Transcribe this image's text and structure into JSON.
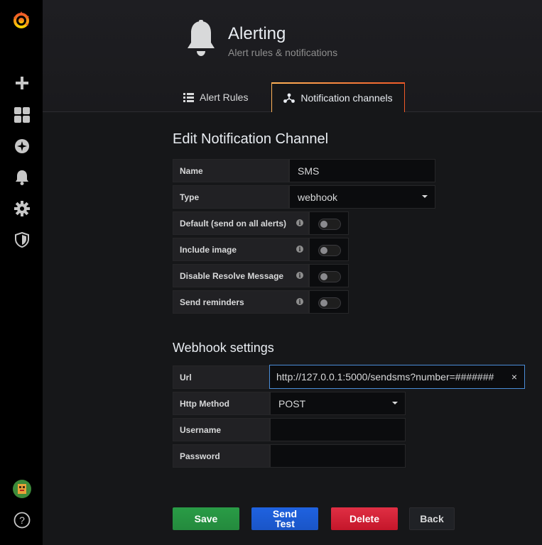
{
  "header": {
    "title": "Alerting",
    "subtitle": "Alert rules & notifications",
    "tabs": [
      {
        "label": "Alert Rules",
        "icon": "list-icon",
        "active": false
      },
      {
        "label": "Notification channels",
        "icon": "channels-icon",
        "active": true
      }
    ]
  },
  "sidebar": {
    "items": [
      {
        "name": "grafana-logo"
      },
      {
        "name": "create-plus-icon"
      },
      {
        "name": "dashboards-icon"
      },
      {
        "name": "explore-compass-icon"
      },
      {
        "name": "alerting-bell-icon"
      },
      {
        "name": "configuration-gear-icon"
      },
      {
        "name": "server-admin-shield-icon"
      },
      {
        "name": "user-avatar"
      },
      {
        "name": "help-icon",
        "label": "?"
      }
    ]
  },
  "form": {
    "title": "Edit Notification Channel",
    "name_label": "Name",
    "name_value": "SMS",
    "type_label": "Type",
    "type_value": "webhook",
    "default_label": "Default (send on all alerts)",
    "include_image_label": "Include image",
    "disable_resolve_label": "Disable Resolve Message",
    "send_reminders_label": "Send reminders",
    "info_glyph": "i"
  },
  "webhook": {
    "title": "Webhook settings",
    "url_label": "Url",
    "url_value": "http://127.0.0.1:5000/sendsms?number=#######",
    "clear_glyph": "×",
    "method_label": "Http Method",
    "method_value": "POST",
    "username_label": "Username",
    "username_value": "",
    "password_label": "Password",
    "password_value": ""
  },
  "buttons": {
    "save": "Save",
    "test_line1": "Send",
    "test_line2": "Test",
    "delete": "Delete",
    "back": "Back"
  },
  "colors": {
    "save": "#299c46",
    "test": "#1f62e0",
    "delete": "#e02f44",
    "accent": "#f05a28"
  }
}
